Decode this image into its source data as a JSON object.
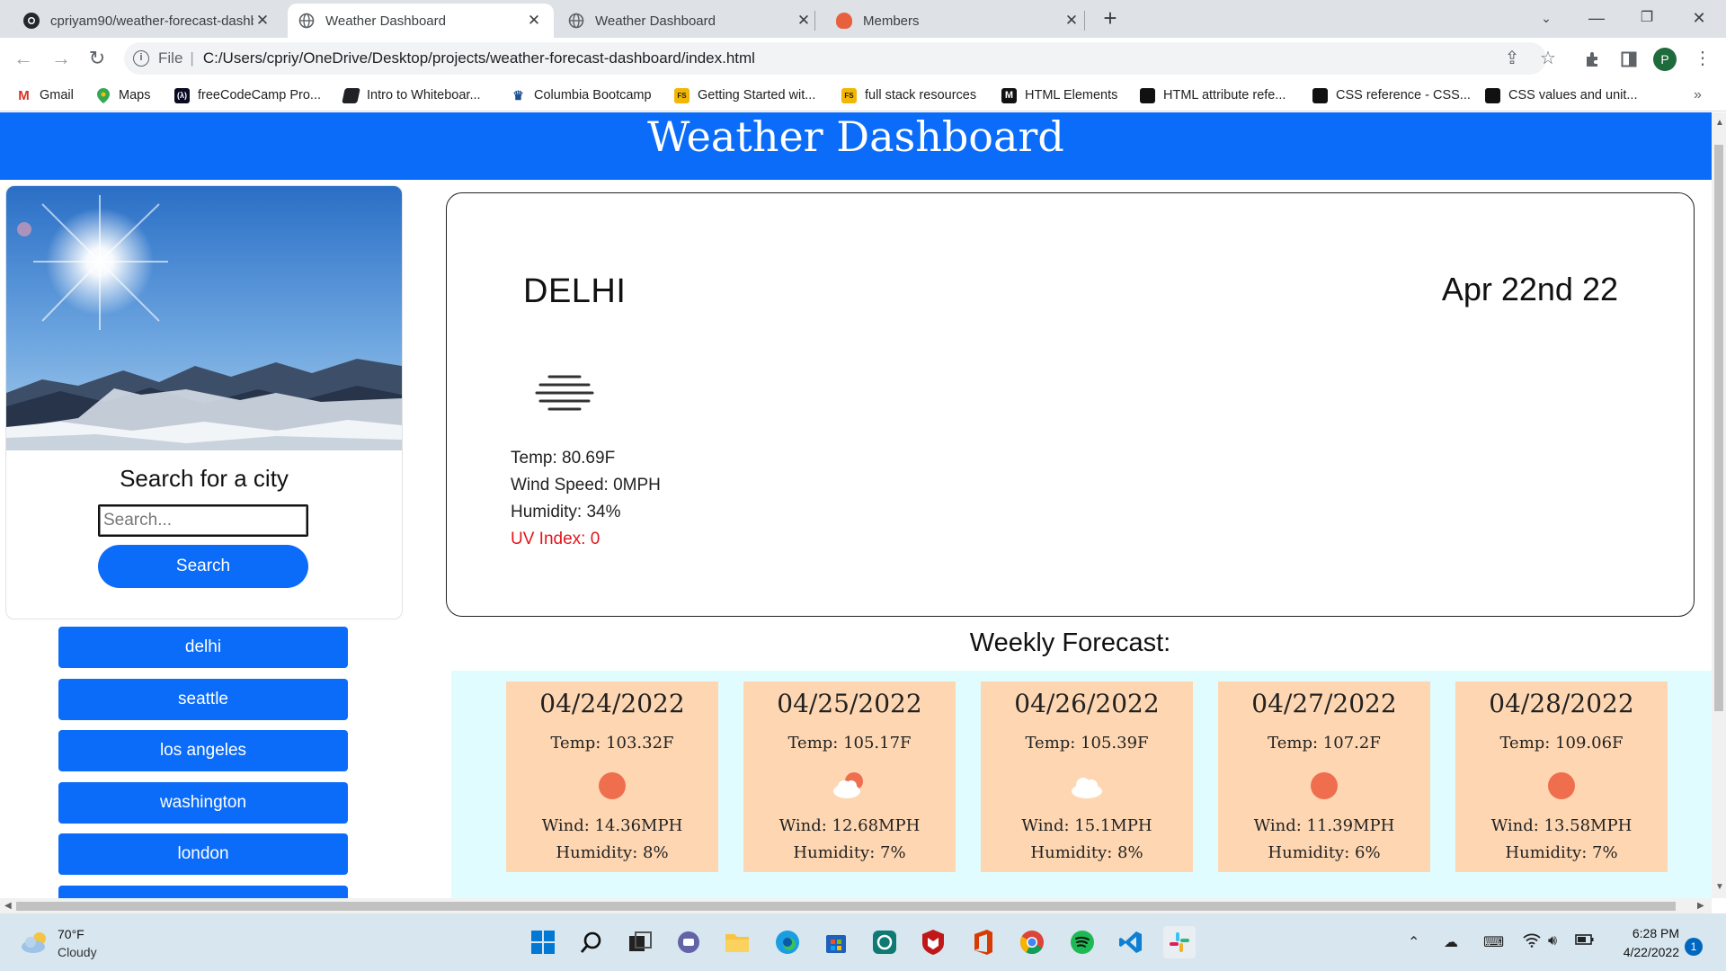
{
  "browser": {
    "tabs": [
      {
        "title": "cpriyam90/weather-forecast-dashboard",
        "favicon": "github-icon",
        "active": false
      },
      {
        "title": "Weather Dashboard",
        "favicon": "globe-icon",
        "active": true
      },
      {
        "title": "Weather Dashboard",
        "favicon": "globe-icon",
        "active": false
      },
      {
        "title": "Members",
        "favicon": "slack-icon",
        "active": false
      }
    ],
    "url_scheme": "File",
    "url": "C:/Users/cpriy/OneDrive/Desktop/projects/weather-forecast-dashboard/index.html",
    "profile_initial": "P",
    "bookmarks": [
      {
        "label": "Gmail",
        "icon": "gmail-icon"
      },
      {
        "label": "Maps",
        "icon": "maps-icon"
      },
      {
        "label": "freeCodeCamp Pro...",
        "icon": "freecodecamp-icon"
      },
      {
        "label": "Intro to Whiteboar...",
        "icon": "whiteboard-icon"
      },
      {
        "label": "Columbia Bootcamp",
        "icon": "columbia-icon"
      },
      {
        "label": "Getting Started wit...",
        "icon": "fullstack-icon"
      },
      {
        "label": "full stack resources",
        "icon": "fullstack-icon"
      },
      {
        "label": "HTML Elements",
        "icon": "mdn-icon"
      },
      {
        "label": "HTML attribute refe...",
        "icon": "mdn-page-icon"
      },
      {
        "label": "CSS reference - CSS...",
        "icon": "mdn-page-icon"
      },
      {
        "label": "CSS values and unit...",
        "icon": "mdn-page-icon"
      }
    ]
  },
  "page": {
    "header_title": "Weather Dashboard",
    "search": {
      "title": "Search for a city",
      "placeholder": "Search...",
      "value": "",
      "button_label": "Search"
    },
    "history": [
      "delhi",
      "seattle",
      "los angeles",
      "washington",
      "london"
    ],
    "current": {
      "city": "DELHI",
      "date": "Apr 22nd 22",
      "icon": "mist-icon",
      "temp": "Temp: 80.69F",
      "wind": "Wind Speed: 0MPH",
      "humidity": "Humidity: 34%",
      "uv": "UV Index: 0",
      "uv_color": "#e3161c"
    },
    "weekly_title": "Weekly Forecast:",
    "forecast": [
      {
        "date": "04/24/2022",
        "temp": "Temp: 103.32F",
        "icon": "sun-icon",
        "wind": "Wind: 14.36MPH",
        "humidity": "Humidity: 8%"
      },
      {
        "date": "04/25/2022",
        "temp": "Temp: 105.17F",
        "icon": "partly-cloudy-icon",
        "wind": "Wind: 12.68MPH",
        "humidity": "Humidity: 7%"
      },
      {
        "date": "04/26/2022",
        "temp": "Temp: 105.39F",
        "icon": "cloud-icon",
        "wind": "Wind: 15.1MPH",
        "humidity": "Humidity: 8%"
      },
      {
        "date": "04/27/2022",
        "temp": "Temp: 107.2F",
        "icon": "sun-icon",
        "wind": "Wind: 11.39MPH",
        "humidity": "Humidity: 6%"
      },
      {
        "date": "04/28/2022",
        "temp": "Temp: 109.06F",
        "icon": "sun-icon",
        "wind": "Wind: 13.58MPH",
        "humidity": "Humidity: 7%"
      }
    ],
    "colors": {
      "accent": "#0b6cf9",
      "forecast_strip": "#e0fcff",
      "forecast_card": "#fed7b2",
      "sun": "#ee6e4e"
    }
  },
  "taskbar": {
    "weather_temp": "70°F",
    "weather_condition": "Cloudy",
    "time": "6:28 PM",
    "date": "4/22/2022",
    "notification_count": "1",
    "apps": [
      "windows-start-icon",
      "search-icon",
      "task-view-icon",
      "teams-chat-icon",
      "file-explorer-icon",
      "edge-icon",
      "microsoft-store-icon",
      "app-icon",
      "mcafee-icon",
      "office-icon",
      "chrome-icon",
      "spotify-icon",
      "vscode-icon",
      "slack-icon"
    ]
  }
}
